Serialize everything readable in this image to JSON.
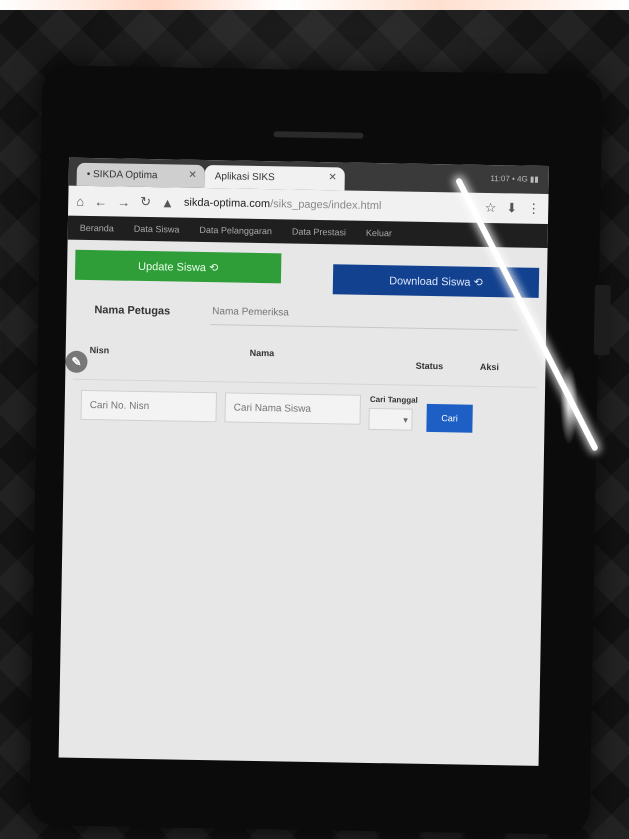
{
  "browser": {
    "tabs": [
      {
        "label": "• SIKDA Optima"
      },
      {
        "label": "Aplikasi SIKS"
      }
    ],
    "url_host": "sikda-optima.com",
    "url_path": "/siks_pages/index.html",
    "status_right": "11:07 • 4G ▮▮"
  },
  "nav": {
    "items": [
      "Beranda",
      "Data Siswa",
      "Data Pelanggaran",
      "Data Prestasi",
      "Keluar"
    ]
  },
  "actions": {
    "update_label": "Update Siswa ⟲",
    "download_label": "Download Siswa ⟲"
  },
  "petugas": {
    "label": "Nama Petugas",
    "placeholder": "Nama Pemeriksa"
  },
  "table": {
    "headers": {
      "nisn": "Nisn",
      "nama": "Nama",
      "status": "Status",
      "aksi": "Aksi"
    }
  },
  "filters": {
    "nisn_placeholder": "Cari No. Nisn",
    "nama_placeholder": "Cari Nama Siswa",
    "tanggal_label": "Cari Tanggal",
    "search_label": "Cari"
  }
}
